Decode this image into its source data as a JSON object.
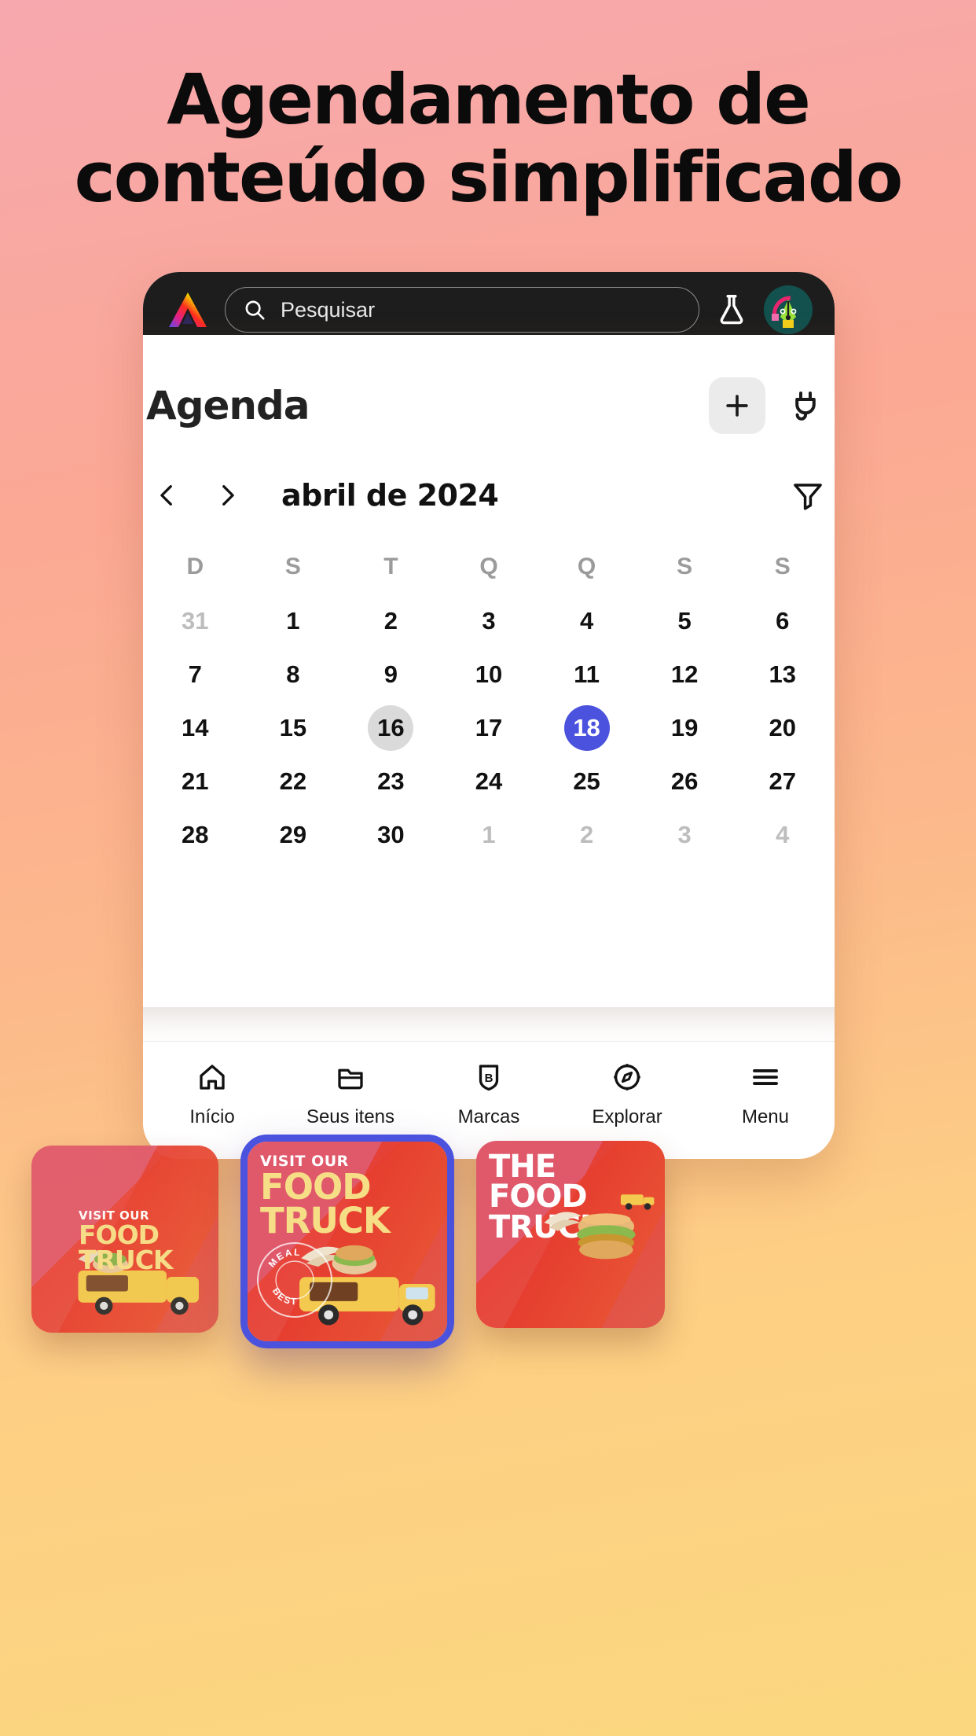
{
  "headline": {
    "line1": "Agendamento de",
    "line2": "conteúdo simplificado"
  },
  "colors": {
    "bg_top": "#f7a8ae",
    "bg_bottom": "#fbd87f",
    "toolbar_bg": "#1d1d1d",
    "selected_day": "#4a52de",
    "today_day": "#dadada",
    "card_red": "#e0596b",
    "card_yellow": "#f6de86"
  },
  "toolbar": {
    "logo": "adobe-express-logo",
    "search_placeholder": "Pesquisar",
    "search_icon": "search-icon",
    "flask_icon": "flask-icon",
    "avatar_icon": "user-avatar"
  },
  "agenda": {
    "title": "Agenda",
    "add_label": "+",
    "add_icon": "plus-icon",
    "plug_icon": "plug-icon",
    "prev_icon": "chevron-left-icon",
    "next_icon": "chevron-right-icon",
    "month_label": "abril de 2024",
    "filter_icon": "filter-icon"
  },
  "calendar": {
    "weekdays": [
      "D",
      "S",
      "T",
      "Q",
      "Q",
      "S",
      "S"
    ],
    "today": 16,
    "selected": 18,
    "weeks": [
      [
        {
          "n": "31",
          "muted": true
        },
        {
          "n": "1"
        },
        {
          "n": "2"
        },
        {
          "n": "3"
        },
        {
          "n": "4"
        },
        {
          "n": "5"
        },
        {
          "n": "6"
        }
      ],
      [
        {
          "n": "7"
        },
        {
          "n": "8"
        },
        {
          "n": "9"
        },
        {
          "n": "10"
        },
        {
          "n": "11"
        },
        {
          "n": "12"
        },
        {
          "n": "13"
        }
      ],
      [
        {
          "n": "14"
        },
        {
          "n": "15"
        },
        {
          "n": "16",
          "today": true
        },
        {
          "n": "17"
        },
        {
          "n": "18",
          "selected": true
        },
        {
          "n": "19"
        },
        {
          "n": "20"
        }
      ],
      [
        {
          "n": "21"
        },
        {
          "n": "22"
        },
        {
          "n": "23"
        },
        {
          "n": "24"
        },
        {
          "n": "25"
        },
        {
          "n": "26"
        },
        {
          "n": "27"
        }
      ],
      [
        {
          "n": "28"
        },
        {
          "n": "29"
        },
        {
          "n": "30"
        },
        {
          "n": "1",
          "muted": true
        },
        {
          "n": "2",
          "muted": true
        },
        {
          "n": "3",
          "muted": true
        },
        {
          "n": "4",
          "muted": true
        }
      ]
    ]
  },
  "cards": [
    {
      "name": "card-food-truck-left",
      "small": "VISIT OUR",
      "big_line1": "FOOD",
      "big_line2": "TRUCK",
      "selected": false
    },
    {
      "name": "card-food-truck-center",
      "small": "VISIT OUR",
      "big_line1": "FOOD",
      "big_line2": "TRUCK",
      "stamp": "BEST MEAL",
      "selected": true
    },
    {
      "name": "card-food-truck-right",
      "small": "THE",
      "big_line1": "FOOD",
      "big_line2": "TRUCK",
      "selected": false
    }
  ],
  "bottom_nav": [
    {
      "label": "Início",
      "icon": "home-icon"
    },
    {
      "label": "Seus itens",
      "icon": "folder-icon"
    },
    {
      "label": "Marcas",
      "icon": "brand-shield-icon"
    },
    {
      "label": "Explorar",
      "icon": "compass-icon"
    },
    {
      "label": "Menu",
      "icon": "hamburger-menu-icon"
    }
  ]
}
